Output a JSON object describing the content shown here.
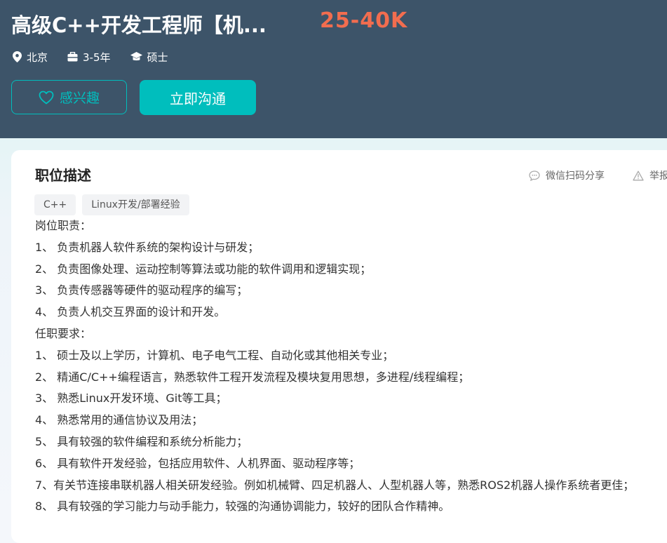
{
  "header": {
    "job_title": "高级C++开发工程师【机...",
    "salary": "25-40K",
    "meta": {
      "city": "北京",
      "experience": "3-5年",
      "degree": "硕士"
    },
    "interest_label": "感兴趣",
    "chat_label": "立即沟通"
  },
  "description": {
    "title": "职位描述",
    "share_label": "微信扫码分享",
    "report_label": "举报",
    "tags": [
      "C++",
      "Linux开发/部署经验"
    ],
    "lines": [
      "岗位职责：",
      "1、 负责机器人软件系统的架构设计与研发；",
      "2、 负责图像处理、运动控制等算法或功能的软件调用和逻辑实现；",
      "3、 负责传感器等硬件的驱动程序的编写；",
      "4、 负责人机交互界面的设计和开发。",
      "任职要求：",
      "1、 硕士及以上学历，计算机、电子电气工程、自动化或其他相关专业；",
      "2、 精通C/C++编程语言，熟悉软件工程开发流程及模块复用思想，多进程/线程编程；",
      "3、 熟悉Linux开发环境、Git等工具；",
      "4、 熟悉常用的通信协议及用法；",
      "5、 具有较强的软件编程和系统分析能力；",
      "6、 具有软件开发经验，包括应用软件、人机界面、驱动程序等；",
      "7、有关节连接串联机器人相关研发经验。例如机械臂、四足机器人、人型机器人等，熟悉ROS2机器人操作系统者更佳；",
      "8、 具有较强的学习能力与动手能力，较强的沟通协调能力，较好的团队合作精神。"
    ]
  },
  "colors": {
    "header_bg": "#3d5469",
    "accent": "#00bebd",
    "salary": "#f26d4f"
  },
  "icons": [
    "location-pin-icon",
    "briefcase-icon",
    "graduation-cap-icon",
    "heart-icon",
    "chat-bubble-icon",
    "warning-triangle-icon"
  ]
}
